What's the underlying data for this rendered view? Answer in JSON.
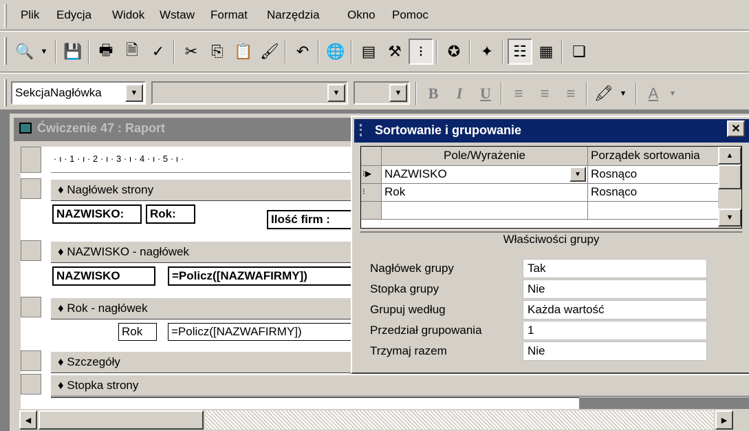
{
  "menu": [
    "Plik",
    "Edycja",
    "Widok",
    "Wstaw",
    "Format",
    "Narzędzia",
    "Okno",
    "Pomoc"
  ],
  "toolbar1_icons": [
    "print-preview-icon",
    "dropdown-arrow-icon",
    "save-icon",
    "print-icon",
    "preview-icon",
    "spell-check-icon",
    "cut-icon",
    "copy-icon",
    "paste-icon",
    "format-painter-icon",
    "undo-icon",
    "hyperlink-icon",
    "field-list-icon",
    "toolbox-icon",
    "sorting-grouping-icon",
    "autoformat-icon",
    "build-icon",
    "properties-icon",
    "database-window-icon",
    "new-object-icon"
  ],
  "toolbar2": {
    "object_combo": "SekcjaNagłówka",
    "font_combo": "",
    "size_combo": "",
    "bold": "B",
    "italic": "I",
    "underline": "U"
  },
  "report_window": {
    "title": "Ćwiczenie 47 : Raport",
    "ruler": "· ı · 1 · ı · 2 · ı · 3 · ı · 4 · ı · 5 · ı ·",
    "bands": {
      "page_header": "Nagłówek strony",
      "name_header": "NAZWISKO - nagłówek",
      "year_header": "Rok - nagłówek",
      "detail": "Szczegóły",
      "page_footer": "Stopka strony"
    },
    "controls": {
      "lbl_name": "NAZWISKO:",
      "lbl_year": "Rok:",
      "lbl_count": "Ilość firm :",
      "txt_name": "NAZWISKO",
      "txt_count1": "=Policz([NAZWAFIRMY])",
      "lbl_year2": "Rok",
      "txt_count2": "=Policz([NAZWAFIRMY])"
    }
  },
  "dialog": {
    "title": "Sortowanie i grupowanie",
    "col_field": "Pole/Wyrażenie",
    "col_order": "Porządek sortowania",
    "rows": [
      {
        "field": "NAZWISKO",
        "order": "Rosnąco"
      },
      {
        "field": "Rok",
        "order": "Rosnąco"
      },
      {
        "field": "",
        "order": ""
      }
    ],
    "group_props_title": "Właściwości grupy",
    "props": [
      {
        "label": "Nagłówek grupy",
        "value": "Tak"
      },
      {
        "label": "Stopka grupy",
        "value": "Nie"
      },
      {
        "label": "Grupuj według",
        "value": "Każda wartość"
      },
      {
        "label": "Przedział grupowania",
        "value": "1"
      },
      {
        "label": "Trzymaj razem",
        "value": "Nie"
      }
    ]
  }
}
